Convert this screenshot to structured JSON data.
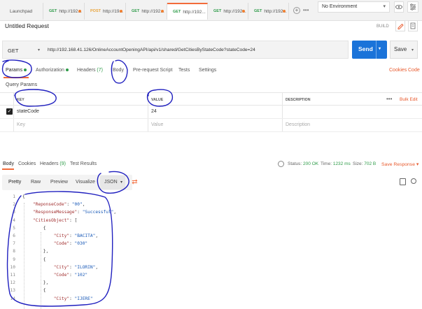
{
  "tabs": [
    {
      "method": "",
      "label": "Launchpad",
      "dot": false,
      "active": false
    },
    {
      "method": "GET",
      "label": "http://192...",
      "dot": true,
      "active": false
    },
    {
      "method": "POST",
      "label": "http://19...",
      "dot": true,
      "active": false
    },
    {
      "method": "GET",
      "label": "http://192...",
      "dot": true,
      "active": false
    },
    {
      "method": "GET",
      "label": "http://192...",
      "dot": false,
      "active": true
    },
    {
      "method": "GET",
      "label": "http://192...",
      "dot": true,
      "active": false
    },
    {
      "method": "GET",
      "label": "http://192...",
      "dot": true,
      "active": false
    }
  ],
  "environment": "No Environment",
  "request": {
    "title": "Untitled Request",
    "build_label": "BUILD",
    "method": "GET",
    "url": "http://192.168.41.126/OnlineAccountOpeningAPI/api/v1/shared/GetCitiesByStateCode?stateCode=24",
    "send_label": "Send",
    "save_label": "Save"
  },
  "request_tabs": {
    "params": "Params",
    "authorization": "Authorization",
    "headers": "Headers",
    "headers_count": "(7)",
    "body": "Body",
    "prerequest": "Pre-request Script",
    "tests": "Tests",
    "settings": "Settings",
    "cookies": "Cookies",
    "code": "Code"
  },
  "query_params": {
    "label": "Query Params",
    "col_key": "KEY",
    "col_value": "VALUE",
    "col_description": "DESCRIPTION",
    "bulk_edit": "Bulk Edit",
    "rows": [
      {
        "key": "stateCode",
        "value": "24",
        "description": ""
      }
    ],
    "placeholder": {
      "key": "Key",
      "value": "Value",
      "description": "Description"
    }
  },
  "response": {
    "tabs": {
      "body": "Body",
      "cookies": "Cookies",
      "headers": "Headers",
      "headers_count": "(9)",
      "test_results": "Test Results"
    },
    "status_label": "Status:",
    "status_value": "200 OK",
    "time_label": "Time:",
    "time_value": "1232 ms",
    "size_label": "Size:",
    "size_value": "702 B",
    "save_response": "Save Response",
    "formats": {
      "pretty": "Pretty",
      "raw": "Raw",
      "preview": "Preview",
      "visualize": "Visualize",
      "json": "JSON"
    }
  },
  "code_lines": [
    {
      "n": "1",
      "text": "{"
    },
    {
      "n": "2",
      "text": "    \"ReponseCode\": \"00\","
    },
    {
      "n": "3",
      "text": "    \"ResponseMessage\": \"Successful\","
    },
    {
      "n": "4",
      "text": "    \"CitiesObject\": ["
    },
    {
      "n": "5",
      "text": "        {"
    },
    {
      "n": "6",
      "text": "            \"City\": \"BACITA\","
    },
    {
      "n": "7",
      "text": "            \"Code\": \"030\""
    },
    {
      "n": "8",
      "text": "        },"
    },
    {
      "n": "9",
      "text": "        {"
    },
    {
      "n": "10",
      "text": "            \"City\": \"ILORIN\","
    },
    {
      "n": "11",
      "text": "            \"Code\": \"102\""
    },
    {
      "n": "12",
      "text": "        },"
    },
    {
      "n": "13",
      "text": "        {"
    },
    {
      "n": "14",
      "text": "            \"City\": \"IJERE\""
    }
  ],
  "colors": {
    "accent": "#f26b3a",
    "send": "#1a73d9",
    "success": "#2d9b48",
    "annotation": "#1f1fbf"
  }
}
